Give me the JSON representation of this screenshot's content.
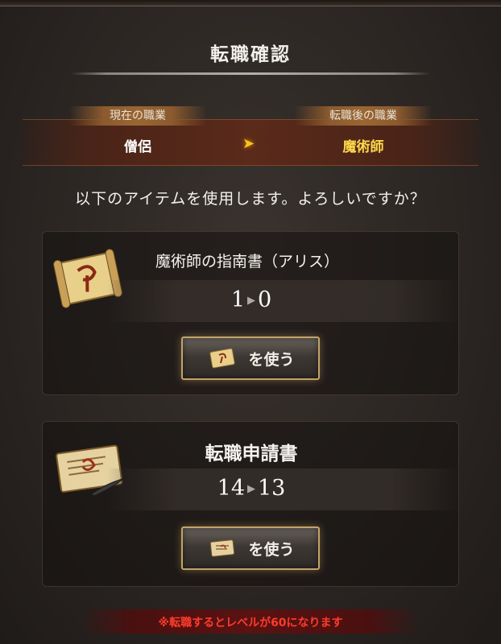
{
  "dialog": {
    "title": "転職確認",
    "question": "以下のアイテムを使用します。よろしいですか？",
    "warning": "※転職するとレベルが60になります"
  },
  "job_change": {
    "current_header": "現在の職業",
    "current_value": "僧侶",
    "arrow": "➤",
    "after_header": "転職後の職業",
    "after_value": "魔術師"
  },
  "items": [
    {
      "icon": "magic-scroll-icon",
      "name": "魔術師の指南書（アリス）",
      "count_before": "1",
      "count_after": "0",
      "use_label": "を使う"
    },
    {
      "icon": "application-document-icon",
      "name": "転職申請書",
      "count_before": "14",
      "count_after": "13",
      "use_label": "を使う"
    }
  ],
  "colors": {
    "accent_gold": "#ffd94a",
    "warning_red": "#ff3b2a",
    "button_border": "#c2a36a"
  }
}
